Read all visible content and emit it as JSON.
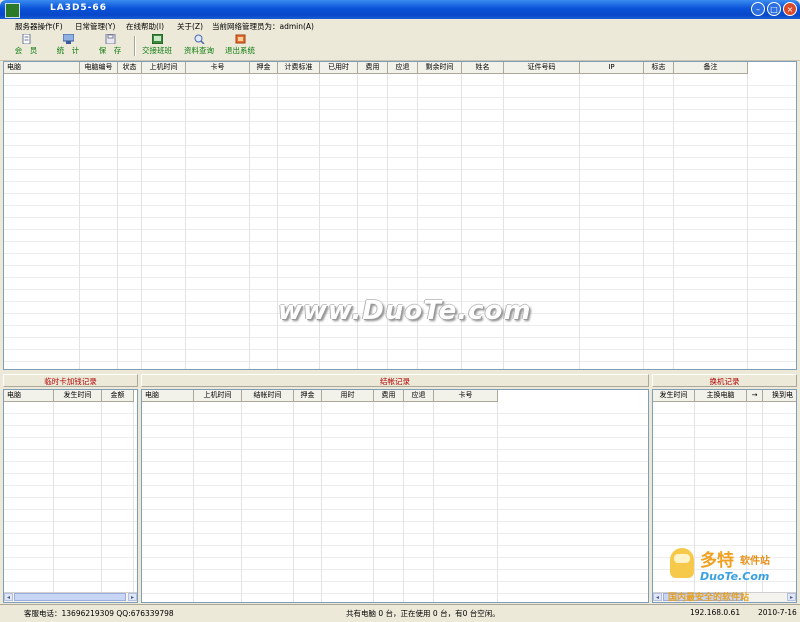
{
  "window": {
    "title": "LA3D5-66"
  },
  "menu": [
    "服务器操作(F)",
    "日常管理(Y)",
    "在线帮助(I)",
    "关于(Z)",
    "当前网络管理员为：admin(A)"
  ],
  "toolbar": [
    {
      "label": "会　员",
      "icon": "member-icon"
    },
    {
      "label": "统　计",
      "icon": "statistics-icon"
    },
    {
      "label": "保　存",
      "icon": "save-icon"
    },
    {
      "label": "交接班班",
      "icon": "shift-handover-icon"
    },
    {
      "label": "资料查询",
      "icon": "data-query-icon"
    },
    {
      "label": "退出系统",
      "icon": "exit-icon"
    }
  ],
  "main_table": {
    "columns": [
      "电脑",
      "电脑编号",
      "状态",
      "上机时间",
      "卡号",
      "押金",
      "计费标准",
      "已用时",
      "费用",
      "应退",
      "剩余时间",
      "姓名",
      "证件号码",
      "IP",
      "标志",
      "备注"
    ]
  },
  "temp_card_panel": {
    "title": "临时卡加钱记录",
    "columns": [
      "电脑",
      "发生时间",
      "金额"
    ]
  },
  "checkout_panel": {
    "title": "结帐记录",
    "columns": [
      "电脑",
      "上机时间",
      "结帐时间",
      "押金",
      "用时",
      "费用",
      "应退",
      "卡号"
    ]
  },
  "swap_panel": {
    "title": "换机记录",
    "columns": [
      "发生时间",
      "主换电脑",
      "→",
      "换到电"
    ]
  },
  "status": {
    "hotline": "客服电话：13696219309  QQ:676339798",
    "summary": "共有电脑 0 台，正在使用 0 台，有0 台空闲。",
    "ip": "192.168.0.61",
    "date": "2010-7-16"
  },
  "watermark": {
    "text": "www.DuoTe.com",
    "logo_big": "多特",
    "logo_small": "软件站",
    "logo_url": "DuoTe.Com",
    "slogan": "国内最安全的软件站"
  },
  "colors": {
    "title_blue": "#0a52d8",
    "panel_title_red": "#b00000",
    "toolbar_label_green": "#0a7a0a"
  }
}
